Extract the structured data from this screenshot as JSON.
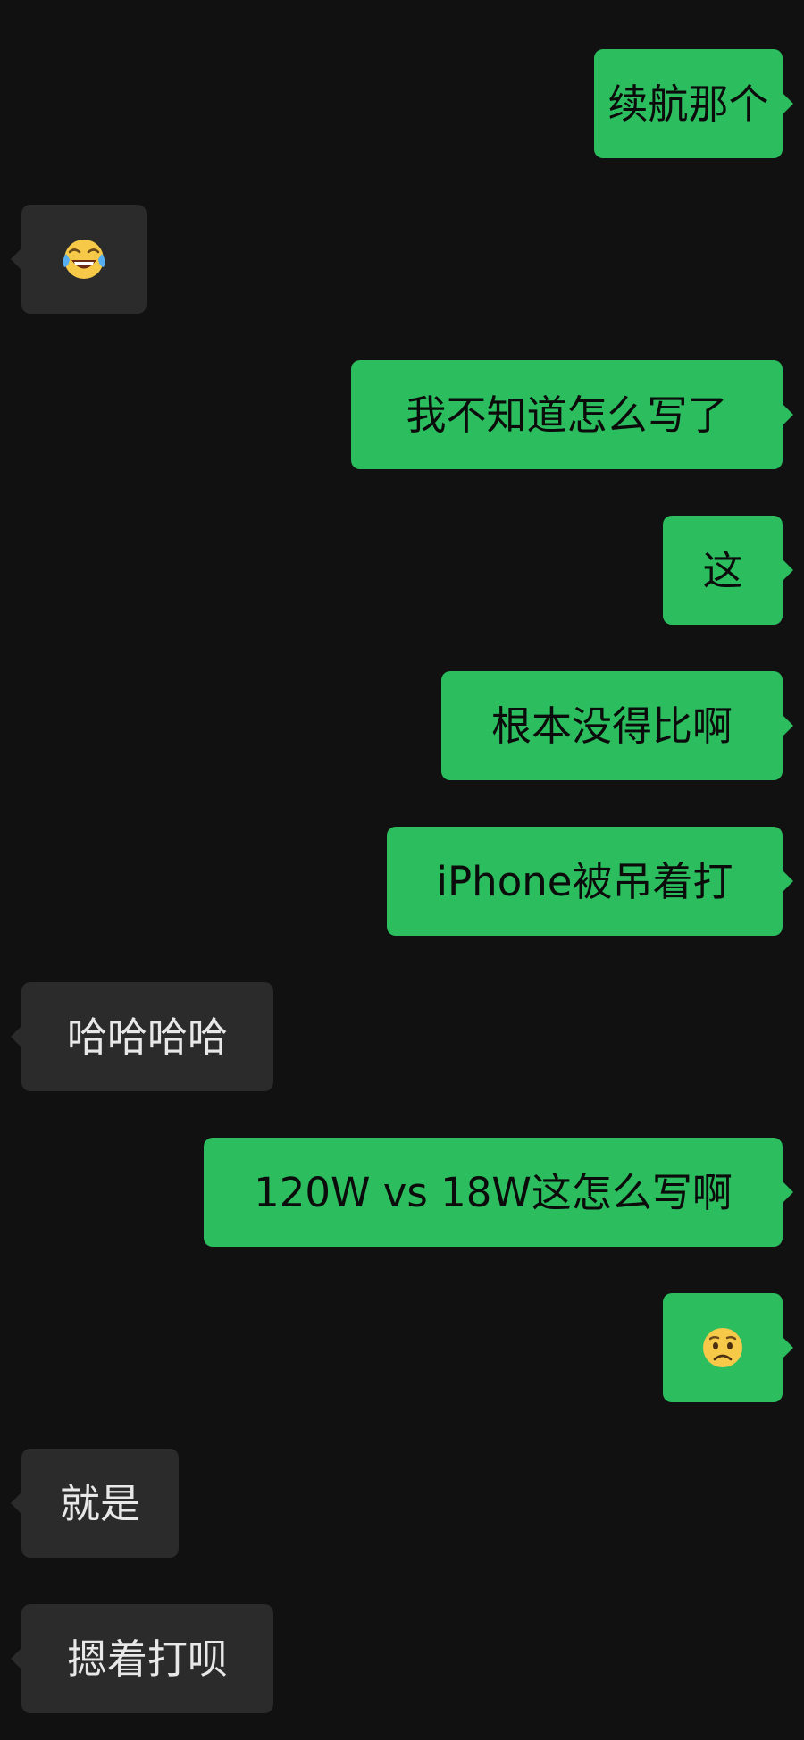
{
  "colors": {
    "background": "#111111",
    "outgoing_bubble": "#2bbd5e",
    "incoming_bubble": "#2b2b2b",
    "outgoing_text": "#0b0b0b",
    "incoming_text": "#e8e8e8"
  },
  "messages": [
    {
      "direction": "outgoing",
      "text": "续航那个"
    },
    {
      "direction": "incoming",
      "emoji": "tears-of-joy-emoji"
    },
    {
      "direction": "outgoing",
      "text": "我不知道怎么写了"
    },
    {
      "direction": "outgoing",
      "text": "这"
    },
    {
      "direction": "outgoing",
      "text": "根本没得比啊"
    },
    {
      "direction": "outgoing",
      "text": "iPhone被吊着打"
    },
    {
      "direction": "incoming",
      "text": "哈哈哈哈"
    },
    {
      "direction": "outgoing",
      "text": "120W vs 18W这怎么写啊"
    },
    {
      "direction": "outgoing",
      "emoji": "frowning-face-emoji"
    },
    {
      "direction": "incoming",
      "text": "就是"
    },
    {
      "direction": "incoming",
      "text": "摁着打呗"
    }
  ]
}
